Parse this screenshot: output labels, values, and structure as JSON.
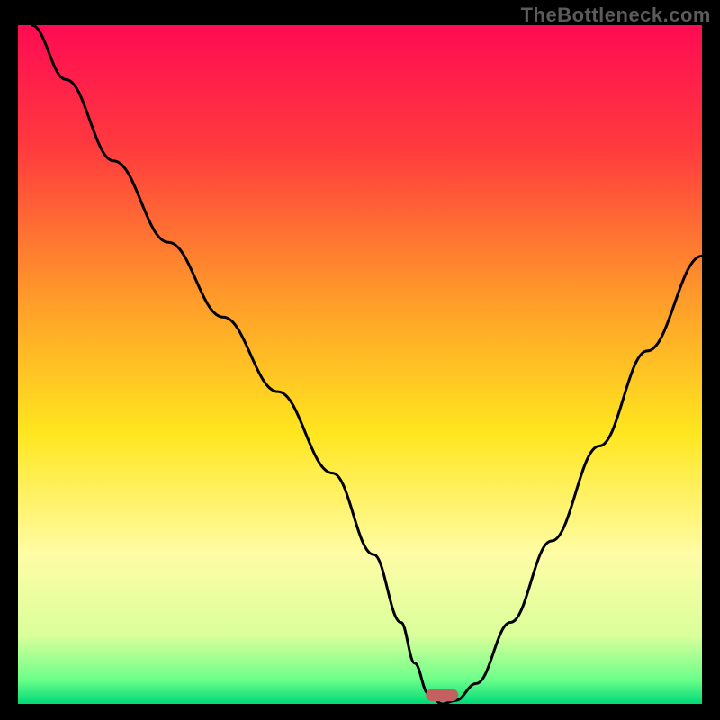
{
  "watermark": "TheBottleneck.com",
  "chart_data": {
    "type": "line",
    "title": "",
    "xlabel": "",
    "ylabel": "",
    "xlim": [
      0,
      100
    ],
    "ylim": [
      0,
      100
    ],
    "series": [
      {
        "name": "bottleneck-curve",
        "x": [
          2,
          7,
          14,
          22,
          30,
          38,
          46,
          52,
          56,
          58,
          60,
          62,
          64,
          67,
          72,
          78,
          85,
          92,
          100
        ],
        "y": [
          100,
          92,
          80,
          68,
          57,
          46,
          34,
          22,
          12,
          6,
          1.5,
          0,
          0.5,
          3,
          12,
          24,
          38,
          52,
          66
        ]
      }
    ],
    "annotations": [
      {
        "name": "optimal-marker",
        "x": 62,
        "y": 1.3,
        "shape": "pill",
        "color": "#c46060"
      }
    ],
    "background_gradient": {
      "direction": "vertical",
      "stops": [
        {
          "pos": 0.0,
          "color": "#ff0b53"
        },
        {
          "pos": 0.18,
          "color": "#ff3a3e"
        },
        {
          "pos": 0.4,
          "color": "#ff9a2a"
        },
        {
          "pos": 0.6,
          "color": "#ffe61f"
        },
        {
          "pos": 0.78,
          "color": "#fffca5"
        },
        {
          "pos": 0.9,
          "color": "#d9ff9a"
        },
        {
          "pos": 0.965,
          "color": "#6aff8a"
        },
        {
          "pos": 1.0,
          "color": "#00d977"
        }
      ]
    }
  }
}
